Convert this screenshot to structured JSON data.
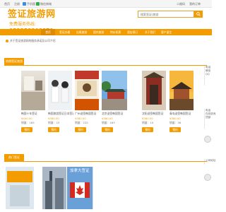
{
  "topbar": {
    "items": [
      "首页",
      "注册",
      "手机版",
      "微信商城"
    ],
    "right_links": [
      "二维码",
      "我的订单"
    ]
  },
  "brand": {
    "name": "签证旅游网",
    "hotline_label": "免费服务热线:",
    "hotline": "053258808879"
  },
  "search": {
    "placeholder": "搜索签证/旅游"
  },
  "nav": {
    "items": [
      "首页",
      "签证办理",
      "出境旅游",
      "国内旅游",
      "特价机票",
      "酒店预订",
      "关于我们",
      "客户留言"
    ]
  },
  "notice": {
    "text": "关于签证旅游网的服务承诺及公司介绍"
  },
  "hot_section": {
    "title": "热销签证旅游",
    "cards": [
      {
        "title": "韩国十年签证",
        "price": "¥400.00",
        "sales": "销量：165"
      },
      {
        "title": "韩国旅游签证日本签证",
        "price": "¥380.00",
        "sales": "销量：23"
      },
      {
        "title": "广州送签韩国签证",
        "price": "¥380.00",
        "sales": "销量：225"
      },
      {
        "title": "北京送签韩国签证",
        "price": "¥380.00",
        "sales": "销量：163"
      },
      {
        "title": "沈阳送签韩国签证",
        "price": "¥380.00",
        "sales": "销量：10"
      },
      {
        "title": "青岛送签韩国签证",
        "price": "¥380.00",
        "sales": "销量：36"
      }
    ],
    "buy_label": "预约"
  },
  "right_sidebar": {
    "group_a": [
      "电话",
      "微信",
      "QQ"
    ],
    "group_b": [
      "电话",
      "在线咨询",
      "顶部"
    ],
    "group_c": [
      "公司地址"
    ]
  },
  "visa_section": {
    "title": "热门签证",
    "cards": [
      {
        "title": ""
      },
      {
        "title": ""
      },
      {
        "title": ""
      },
      {
        "title": "加拿大签证"
      }
    ],
    "banner_text": "加拿大签证"
  },
  "colors": {
    "brand": "#f39c00",
    "nav": "#f39c00",
    "price": "#f39c00"
  },
  "icons": [
    "search-icon",
    "mobile-icon",
    "wechat-icon",
    "notice-icon"
  ]
}
